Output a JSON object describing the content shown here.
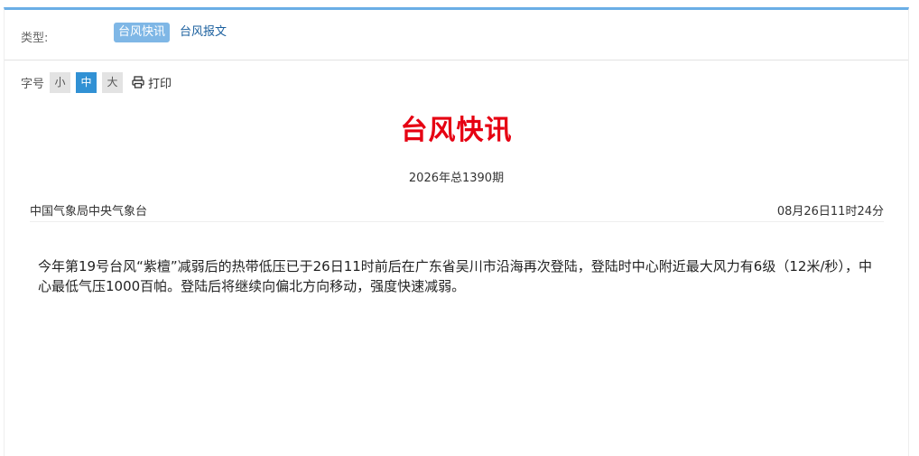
{
  "type_bar": {
    "label": "类型:",
    "options": [
      "台风快讯",
      "台风报文"
    ],
    "selected": "台风快讯"
  },
  "font_size": {
    "label": "字号",
    "options": [
      "小",
      "中",
      "大"
    ],
    "selected": "中",
    "print_label": "打印"
  },
  "article": {
    "title": "台风快讯",
    "issue": "2026年总1390期",
    "source": "中国气象局中央气象台",
    "datetime": "08月26日11时24分",
    "body": "今年第19号台风“紫檀”减弱后的热带低压已于26日11时前后在广东省吴川市沿海再次登陆，登陆时中心附近最大风力有6级（12米/秒），中心最低气压1000百帕。登陆后将继续向偏北方向移动，强度快速减弱。"
  },
  "colors": {
    "accent": "#6aaee6",
    "title_red": "#e60012",
    "active_size": "#3191d4"
  },
  "icons": {
    "print": "printer-icon"
  }
}
